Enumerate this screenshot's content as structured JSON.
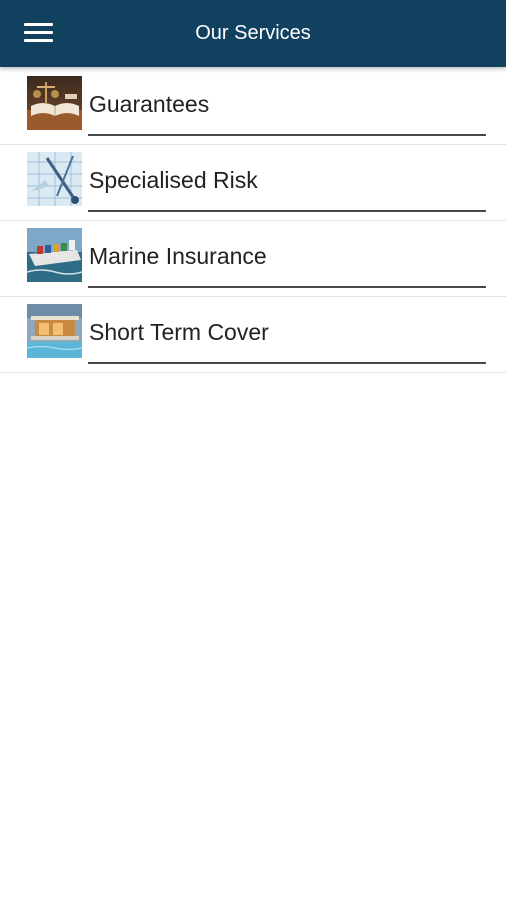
{
  "app_bar": {
    "title": "Our Services",
    "menu_icon": "hamburger-menu-icon",
    "background_color": "#12405f"
  },
  "services": [
    {
      "label": "Guarantees",
      "thumbnail": "guarantees-image"
    },
    {
      "label": "Specialised Risk",
      "thumbnail": "specialised-risk-image"
    },
    {
      "label": "Marine Insurance",
      "thumbnail": "marine-insurance-image"
    },
    {
      "label": "Short Term Cover",
      "thumbnail": "short-term-cover-image"
    }
  ]
}
